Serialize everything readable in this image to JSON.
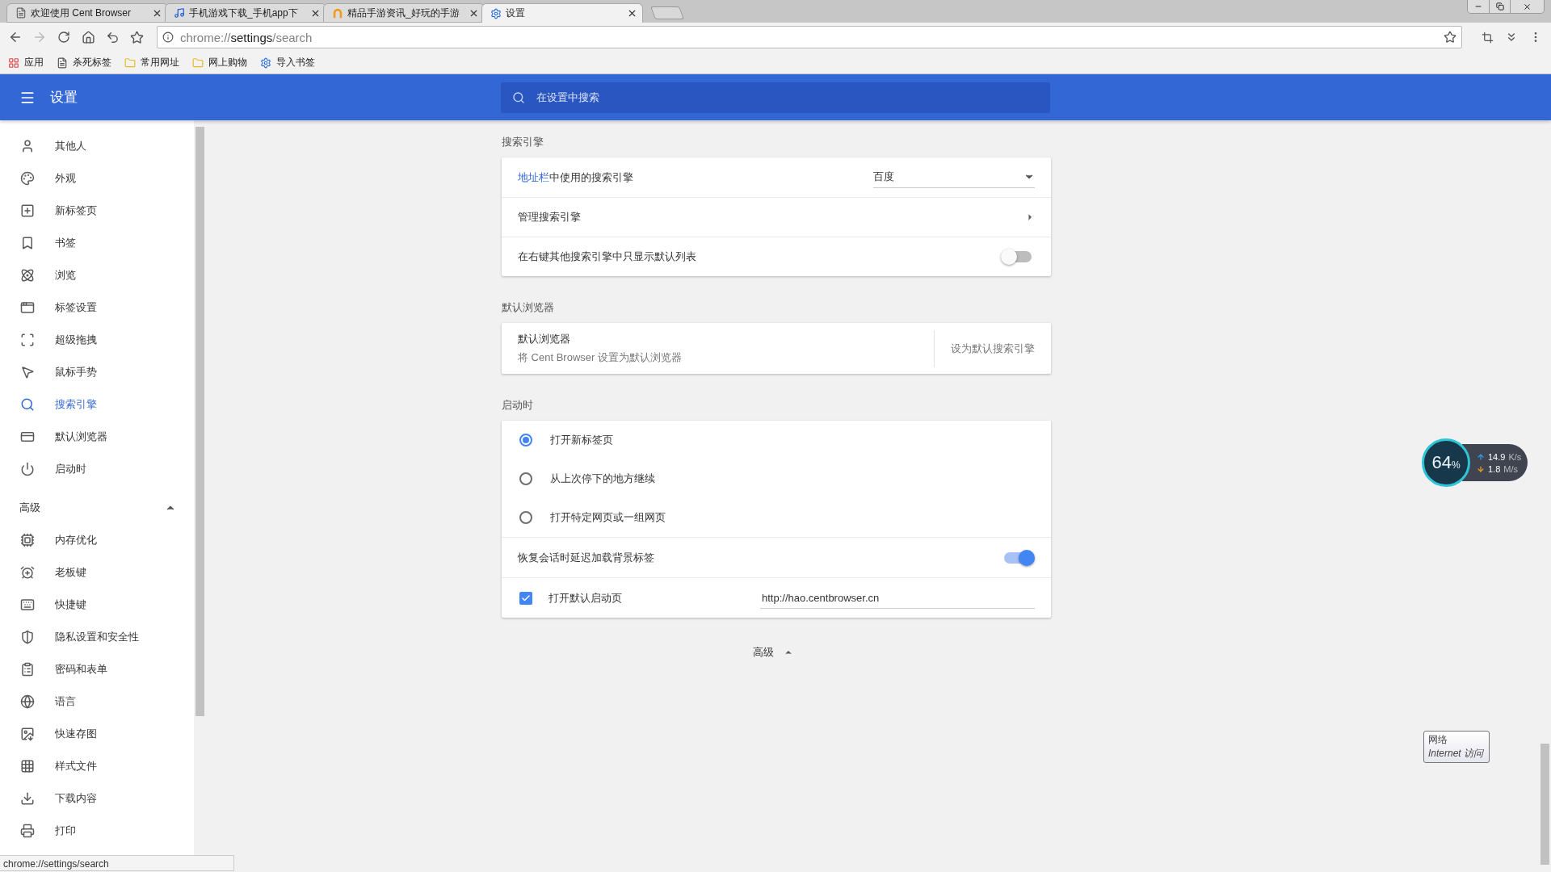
{
  "tabs": [
    {
      "title": "欢迎使用 Cent Browser",
      "kind": "page",
      "selected": false
    },
    {
      "title": "手机游戏下载_手机app下",
      "kind": "note",
      "selected": false
    },
    {
      "title": "精品手游资讯_好玩的手游",
      "kind": "arch",
      "selected": false
    },
    {
      "title": "设置",
      "kind": "gear",
      "selected": true
    }
  ],
  "address": {
    "scheme": "chrome://",
    "host": "settings",
    "path": "/search"
  },
  "bookmarks": [
    {
      "label": "应用",
      "kind": "apps"
    },
    {
      "label": "杀死标签",
      "kind": "page"
    },
    {
      "label": "常用网址",
      "kind": "folder"
    },
    {
      "label": "网上购物",
      "kind": "folder"
    },
    {
      "label": "导入书签",
      "kind": "gear"
    }
  ],
  "header": {
    "title": "设置",
    "search_placeholder": "在设置中搜索"
  },
  "sidebar": {
    "items": [
      {
        "label": "其他人",
        "kind": "person",
        "selected": false
      },
      {
        "label": "外观",
        "kind": "palette",
        "selected": false
      },
      {
        "label": "新标签页",
        "kind": "newtab",
        "selected": false
      },
      {
        "label": "书签",
        "kind": "bookmark",
        "selected": false
      },
      {
        "label": "浏览",
        "kind": "atom",
        "selected": false
      },
      {
        "label": "标签设置",
        "kind": "tabs",
        "selected": false
      },
      {
        "label": "超级拖拽",
        "kind": "drag",
        "selected": false
      },
      {
        "label": "鼠标手势",
        "kind": "pointer",
        "selected": false
      },
      {
        "label": "搜索引擎",
        "kind": "search",
        "selected": true
      },
      {
        "label": "默认浏览器",
        "kind": "browser",
        "selected": false
      },
      {
        "label": "启动时",
        "kind": "power",
        "selected": false
      }
    ],
    "advanced": {
      "label": "高级",
      "expanded": true,
      "items": [
        {
          "label": "内存优化",
          "kind": "chip",
          "selected": false
        },
        {
          "label": "老板键",
          "kind": "alarm",
          "selected": false
        },
        {
          "label": "快捷键",
          "kind": "keyboard",
          "selected": false
        },
        {
          "label": "隐私设置和安全性",
          "kind": "shield",
          "selected": false
        },
        {
          "label": "密码和表单",
          "kind": "clipboard",
          "selected": false
        },
        {
          "label": "语言",
          "kind": "globe",
          "selected": false
        },
        {
          "label": "快速存图",
          "kind": "image",
          "selected": false
        },
        {
          "label": "样式文件",
          "kind": "grid",
          "selected": false
        },
        {
          "label": "下载内容",
          "kind": "download",
          "selected": false
        },
        {
          "label": "打印",
          "kind": "printer",
          "selected": false
        }
      ]
    }
  },
  "search_engine": {
    "title": "搜索引擎",
    "link": "地址栏",
    "label": "中使用的搜索引擎",
    "value": "百度",
    "manage": "管理搜索引擎",
    "context_toggle": {
      "label": "在右键其他搜索引擎中只显示默认列表",
      "on": false
    }
  },
  "default_browser": {
    "title": "默认浏览器",
    "label": "默认浏览器",
    "description": "将 Cent Browser 设置为默认浏览器",
    "button": "设为默认搜索引擎"
  },
  "startup": {
    "title": "启动时",
    "options": [
      {
        "label": "打开新标签页",
        "selected": true
      },
      {
        "label": "从上次停下的地方继续",
        "selected": false
      },
      {
        "label": "打开特定网页或一组网页",
        "selected": false
      }
    ],
    "lazy_toggle": {
      "label": "恢复会话时延迟加载背景标签",
      "on": true
    },
    "home_page": {
      "label": "打开默认启动页",
      "checked": true,
      "value": "http://hao.centbrowser.cn"
    }
  },
  "advanced_button": {
    "label": "高级",
    "expanded": true
  },
  "status_bar": "chrome://settings/search",
  "net_widget": {
    "percent": "64",
    "unit": "%",
    "up": "14.9",
    "up_unit": "K/s",
    "down": "1.8",
    "down_unit": "M/s"
  },
  "tooltip": {
    "title": "网络",
    "subtitle": "Internet 访问"
  }
}
